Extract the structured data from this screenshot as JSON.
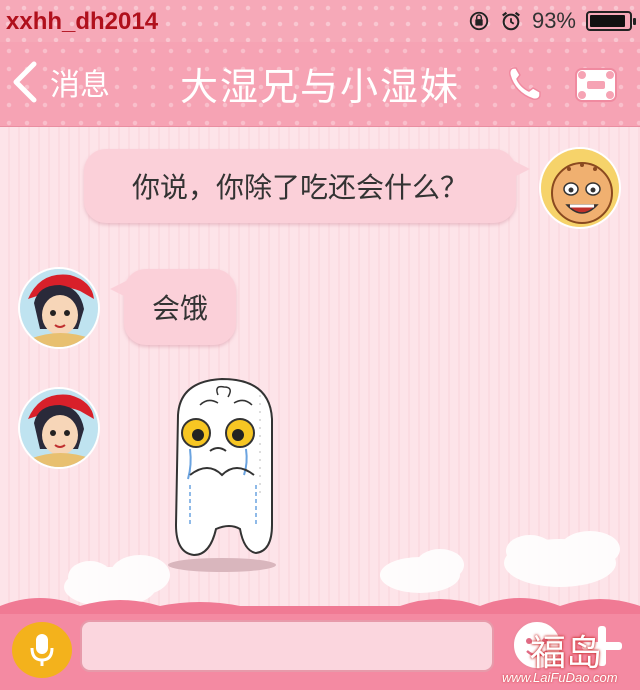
{
  "status_bar": {
    "watermark_user": "xxhh_dh2014",
    "battery_percent_text": "93%",
    "battery_level": 0.93,
    "icons": [
      "rotation-lock-icon",
      "alarm-icon",
      "battery-icon"
    ]
  },
  "nav": {
    "back_label": "消息",
    "title": "大湿兄与小湿妹",
    "icons": [
      "back-chevron-icon",
      "phone-icon",
      "profile-card-icon"
    ]
  },
  "messages": [
    {
      "sender": "monk",
      "direction": "outgoing",
      "text": "你说，你除了吃还会什么？"
    },
    {
      "sender": "girl",
      "direction": "incoming",
      "text": "会饿"
    },
    {
      "sender": "girl",
      "direction": "incoming",
      "sticker": "crying-tooth-sticker"
    }
  ],
  "input_bar": {
    "placeholder": "",
    "icons": [
      "microphone-icon",
      "emoji-icon",
      "plus-icon"
    ]
  },
  "watermark": {
    "brand": "福岛",
    "url": "www.LaiFuDao.com"
  },
  "colors": {
    "nav_pink": "#f6a3b4",
    "bubble_pink": "#fbd0d9",
    "mic_yellow": "#f3b21c",
    "watermark_red": "#b0101c"
  }
}
